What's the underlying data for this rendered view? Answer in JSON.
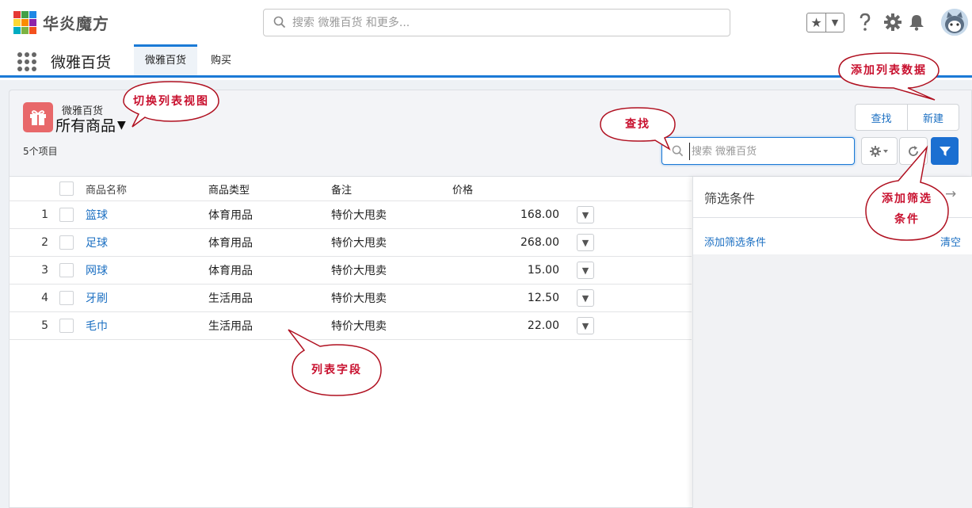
{
  "header": {
    "brand_name": "华炎魔方",
    "logo_colors": [
      "#e53935",
      "#43a047",
      "#1e88e5",
      "#fdd835",
      "#fb8c00",
      "#8e24aa",
      "#00acc1",
      "#7cb342",
      "#f4511e"
    ],
    "search_placeholder": "搜索 微雅百货 和更多...",
    "icons": [
      "star-icon",
      "chevron-down-icon",
      "help-icon",
      "gear-icon",
      "bell-icon",
      "avatar"
    ]
  },
  "nav": {
    "app_name": "微雅百货",
    "tabs": [
      {
        "label": "微雅百货",
        "active": true
      },
      {
        "label": "购买",
        "active": false
      }
    ],
    "accent_color": "#1b7ad6"
  },
  "list_view": {
    "object_label": "微雅百货",
    "view_name": "所有商品",
    "item_count": "5个项目",
    "buttons": {
      "find": "查找",
      "new": "新建"
    },
    "search_placeholder": "搜索 微雅百货",
    "columns": {
      "name": "商品名称",
      "type": "商品类型",
      "note": "备注",
      "price": "价格"
    },
    "rows": [
      {
        "num": "1",
        "name": "篮球",
        "type": "体育用品",
        "note": "特价大甩卖",
        "price": "168.00"
      },
      {
        "num": "2",
        "name": "足球",
        "type": "体育用品",
        "note": "特价大甩卖",
        "price": "268.00"
      },
      {
        "num": "3",
        "name": "网球",
        "type": "体育用品",
        "note": "特价大甩卖",
        "price": "15.00"
      },
      {
        "num": "4",
        "name": "牙刷",
        "type": "生活用品",
        "note": "特价大甩卖",
        "price": "12.50"
      },
      {
        "num": "5",
        "name": "毛巾",
        "type": "生活用品",
        "note": "特价大甩卖",
        "price": "22.00"
      }
    ]
  },
  "filter_panel": {
    "title": "筛选条件",
    "add_condition": "添加筛选条件",
    "clear": "清空"
  },
  "annotations": {
    "switch_view": "切换列表视图",
    "add_data": "添加列表数据",
    "find": "查找",
    "add_filter_line1": "添加筛选",
    "add_filter_line2": "条件",
    "fields": "列表字段",
    "color": "#c8102e"
  }
}
